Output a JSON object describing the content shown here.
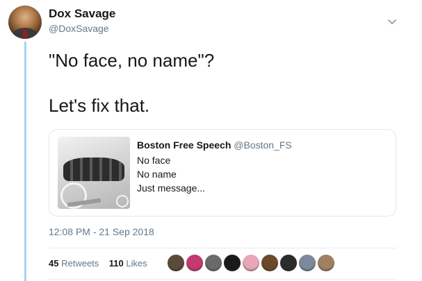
{
  "author": {
    "display_name": "Dox Savage",
    "handle": "@DoxSavage",
    "avatar_icon": "profile-photo"
  },
  "tweet": {
    "lines": [
      "\"No face, no name\"?",
      "Let's fix that."
    ]
  },
  "menu_icon": "chevron-down-icon",
  "quoted_tweet": {
    "author_name": "Boston Free Speech",
    "author_handle": "@Boston_FS",
    "lines": [
      "No face",
      "No name",
      "Just message..."
    ],
    "image_icon": "protest-photo"
  },
  "timestamp": "12:08 PM - 21 Sep 2018",
  "stats": {
    "retweets_count": "45",
    "retweets_label": "Retweets",
    "likes_count": "110",
    "likes_label": "Likes"
  },
  "likers": {
    "colors": [
      "#5b4a3a",
      "#c23a6e",
      "#6a6a6a",
      "#1a1a1a",
      "#e7a7b8",
      "#6b4a2a",
      "#2c2c2c",
      "#7a8a9a",
      "#a08060"
    ]
  },
  "colors": {
    "text_primary": "#14171a",
    "text_secondary": "#657786",
    "thread_line": "#a8d4f0",
    "border": "#e1e8ed"
  }
}
